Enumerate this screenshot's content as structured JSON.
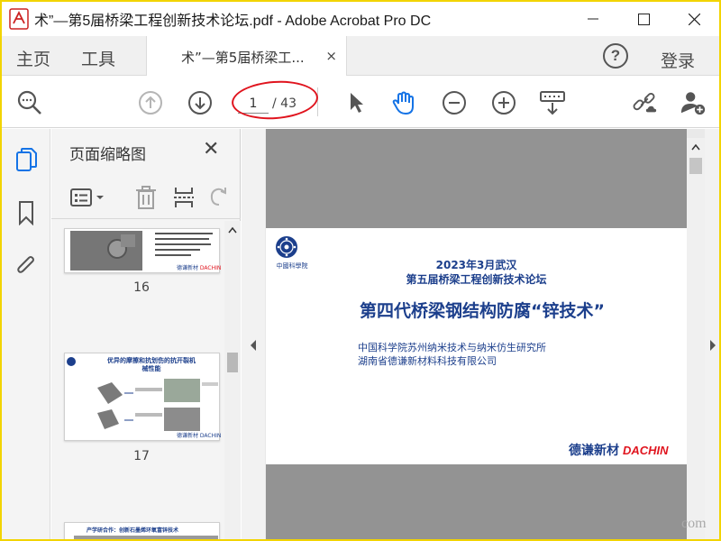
{
  "window": {
    "title": "术”—第5届桥梁工程创新技术论坛.pdf - Adobe Acrobat Pro DC",
    "controls": {
      "minimize": "—",
      "maximize": "☐",
      "close": "✕"
    }
  },
  "tabs": {
    "home": "主页",
    "tools": "工具",
    "document": "术”—第5届桥梁工...",
    "close": "×",
    "help": "?",
    "sign_in": "登录"
  },
  "toolbar": {
    "current_page": "1",
    "total_pages": "/ 43",
    "icons": [
      "magnify-icon",
      "page-up-icon",
      "page-down-icon",
      "select-arrow-icon",
      "hand-icon",
      "zoom-out-icon",
      "zoom-in-icon",
      "keyboard-scroll-icon",
      "share-link-icon",
      "add-user-icon"
    ],
    "highlight_color": "#e0141e",
    "accent": "#1473e6"
  },
  "rail": {
    "icons": [
      "pages-icon",
      "bookmark-icon",
      "attachment-icon"
    ]
  },
  "panel": {
    "title": "页面缩略图",
    "close": "✕",
    "tools": [
      "thumbnail-options-icon",
      "delete-icon",
      "extract-icon",
      "rotate-icon"
    ],
    "thumbnails": [
      {
        "page": "16"
      },
      {
        "page": "17",
        "heading": "优异的摩擦和抗划伤的抗开裂机械性能",
        "brand": "德谦新材 DACHIN"
      },
      {
        "heading": "产学研合作：创新石墨烯环氧富锌技术"
      }
    ]
  },
  "slide": {
    "logo_text": "中國科學院",
    "date": "2023年3月武汉",
    "forum": "第五届桥梁工程创新技术论坛",
    "title": "第四代桥梁钢结构防腐“锌技术”",
    "org1": "中国科学院苏州纳米技术与纳米仿生研究所",
    "org2": "湖南省德谦新材料科技有限公司",
    "brand_cn": "德谦新材",
    "brand_en": "DACHIN",
    "text_color": "#1c3f8c"
  },
  "watermark": "com"
}
